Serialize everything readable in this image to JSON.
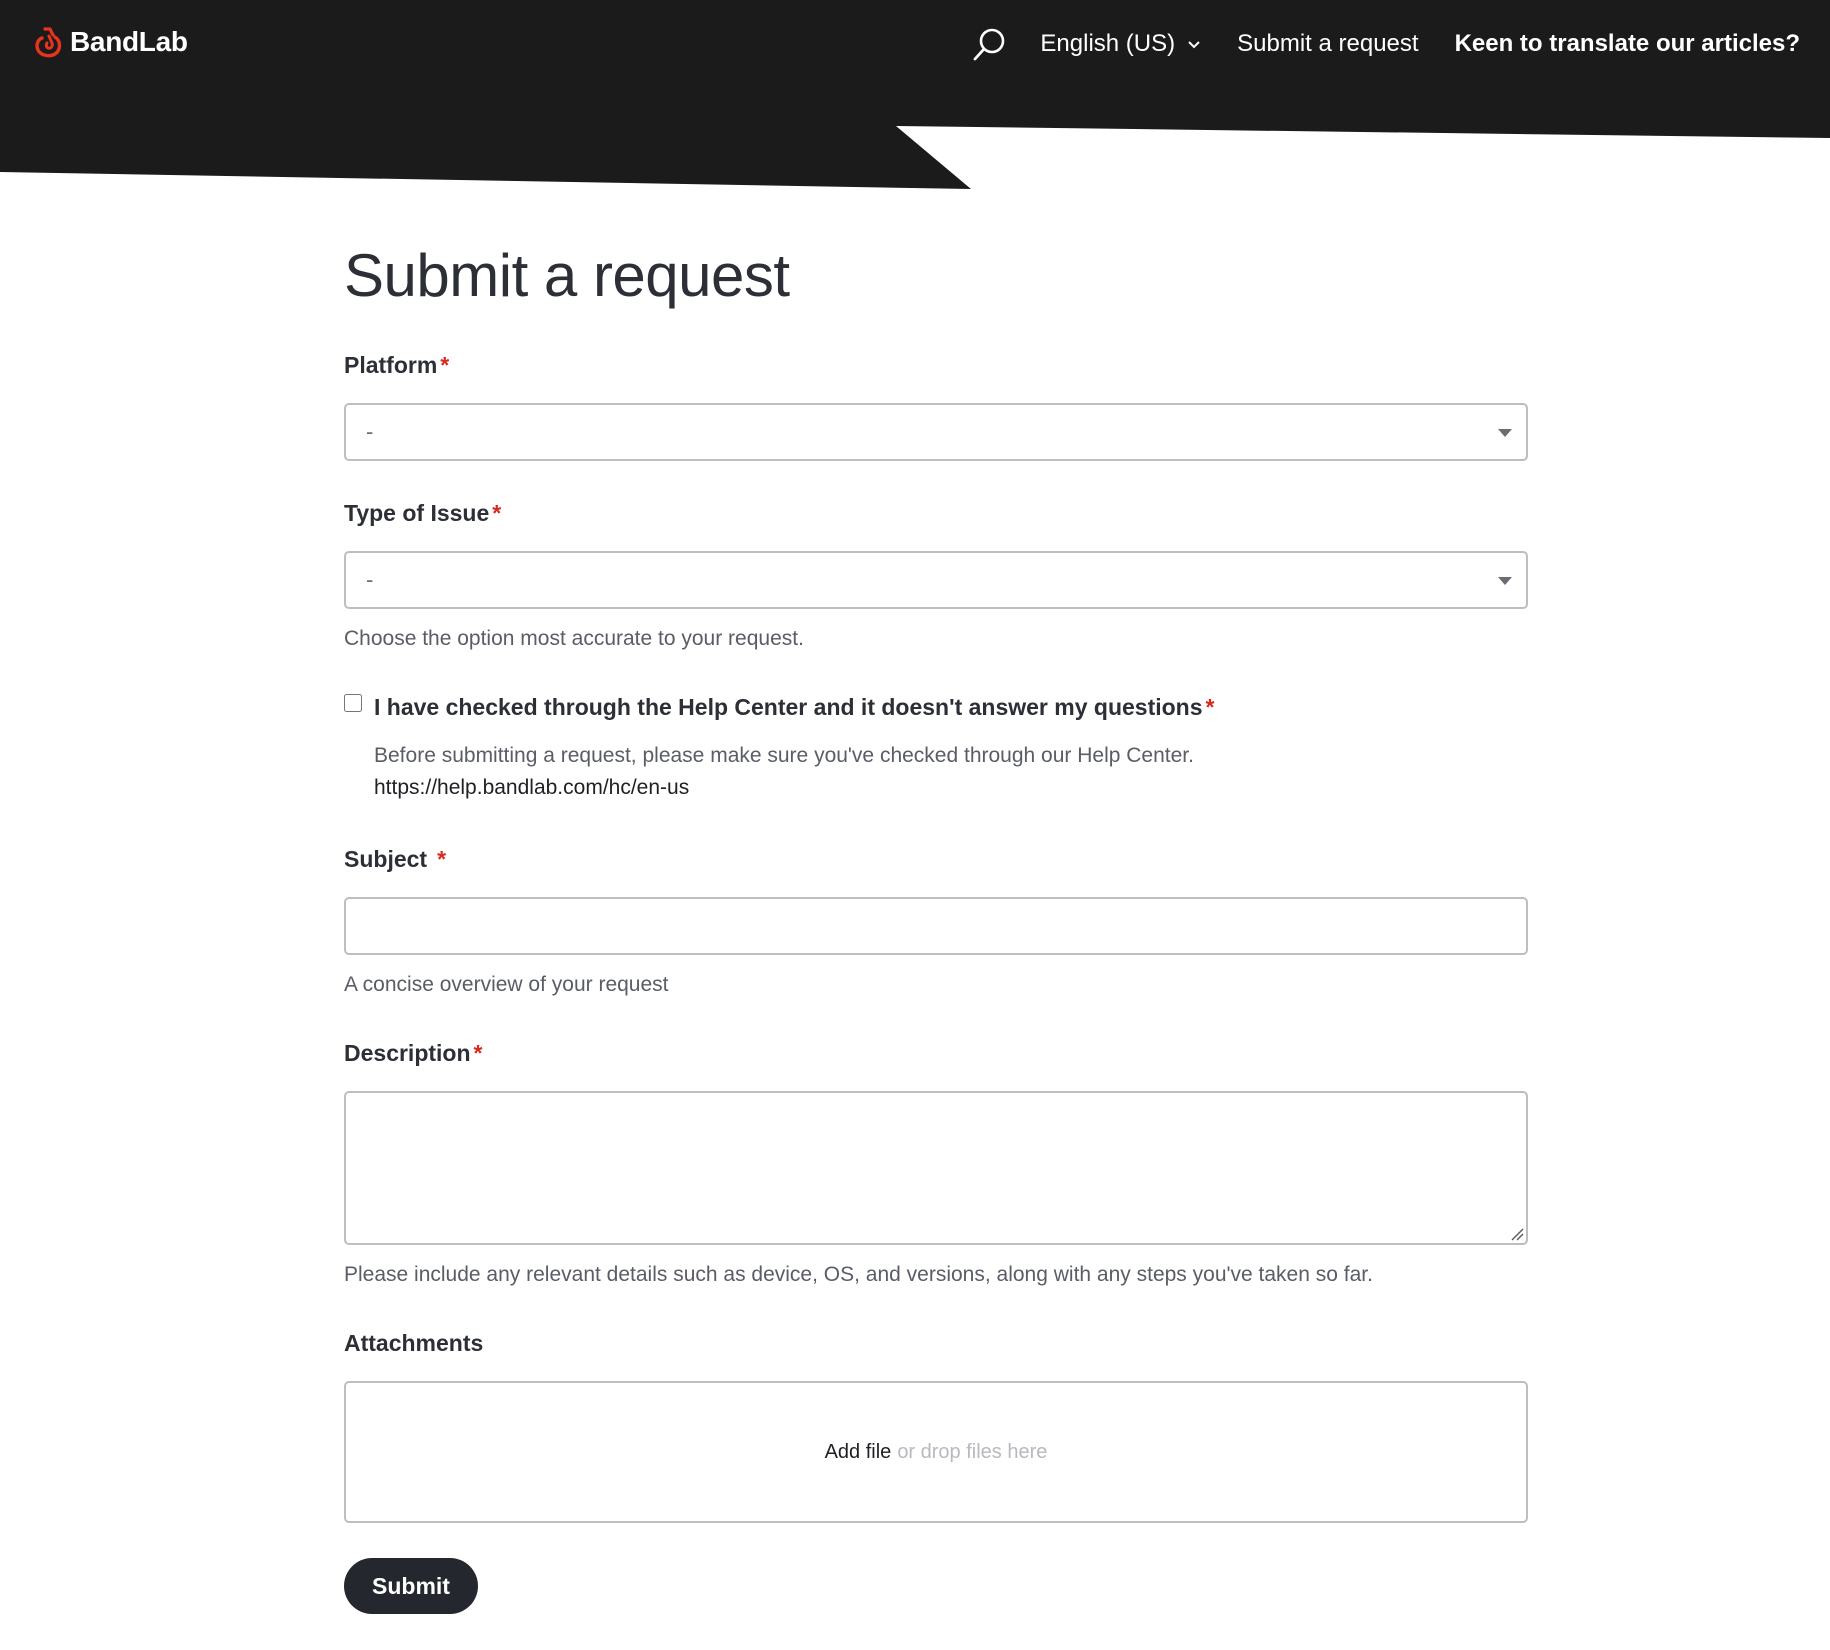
{
  "header": {
    "brand": "BandLab",
    "language": "English (US)",
    "nav_submit": "Submit a request",
    "nav_translate": "Keen to translate our articles?"
  },
  "form": {
    "title": "Submit a request",
    "platform": {
      "label": "Platform",
      "value": "-"
    },
    "issue_type": {
      "label": "Type of Issue",
      "value": "-",
      "hint": "Choose the option most accurate to your request."
    },
    "help_check": {
      "label": "I have checked through the Help Center and it doesn't answer my questions",
      "checked": false,
      "help": "Before submitting a request, please make sure you've checked through our Help Center.",
      "link": "https://help.bandlab.com/hc/en-us"
    },
    "subject": {
      "label": "Subject",
      "value": "",
      "hint": "A concise overview of your request"
    },
    "description": {
      "label": "Description",
      "value": "",
      "hint": "Please include any relevant details such as device, OS, and versions, along with any steps you've taken so far."
    },
    "attachments": {
      "label": "Attachments",
      "add_file": "Add file",
      "drop_text": "or drop files here"
    },
    "required_mark": "*",
    "submit_label": "Submit"
  },
  "colors": {
    "header_bg": "#1b1b1b",
    "brand_red": "#e8341c",
    "required_red": "#d8291c",
    "button_dark": "#24272e"
  },
  "icons": {
    "search": "search-icon",
    "language_chevron": "chevron-down-icon",
    "logo": "bandlab-logo-icon"
  }
}
